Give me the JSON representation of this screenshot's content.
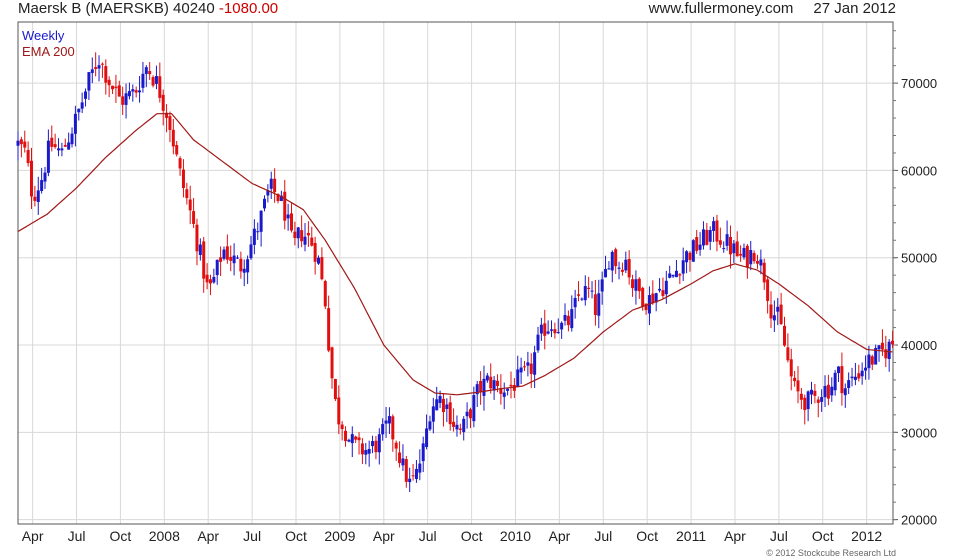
{
  "header": {
    "title": "Maersk B (MAERSKB)",
    "price": "40240",
    "change": "-1080.00",
    "source": "www.fullermoney.com",
    "date": "27 Jan 2012"
  },
  "footer": {
    "copyright": "© 2012 Stockcube Research Ltd"
  },
  "colors": {
    "up": "#1a1acc",
    "down": "#e01010",
    "ema": "#a01818",
    "grid": "#d8d8d8"
  },
  "chart_data": {
    "type": "candlestick",
    "legend": [
      "Weekly",
      "EMA 200"
    ],
    "legend_colors": [
      "#1a1acc",
      "#a01818"
    ],
    "legend_placement": "top-left",
    "x_ticks": [
      "Apr",
      "Jul",
      "Oct",
      "2008",
      "Apr",
      "Jul",
      "Oct",
      "2009",
      "Apr",
      "Jul",
      "Oct",
      "2010",
      "Apr",
      "Jul",
      "Oct",
      "2011",
      "Apr",
      "Jul",
      "Oct",
      "2012"
    ],
    "x_range_months": [
      0,
      59.8
    ],
    "y_ticks": [
      20000,
      30000,
      40000,
      50000,
      60000,
      70000
    ],
    "y_tick_labels": [
      "20000",
      "30000",
      "40000",
      "50000",
      "60000",
      "70000"
    ],
    "ylim": [
      19500,
      77000
    ],
    "y_axis_side": "right",
    "grid": true,
    "close_keyframes_month_value": [
      [
        0,
        63000
      ],
      [
        0.5,
        62000
      ],
      [
        1,
        57000
      ],
      [
        1.6,
        59000
      ],
      [
        2.2,
        63000
      ],
      [
        3,
        62000
      ],
      [
        4,
        66000
      ],
      [
        4.8,
        70000
      ],
      [
        5.5,
        73000
      ],
      [
        6.3,
        70000
      ],
      [
        7,
        68000
      ],
      [
        8,
        69000
      ],
      [
        8.8,
        72000
      ],
      [
        9.5,
        70000
      ],
      [
        10.3,
        66000
      ],
      [
        11,
        60000
      ],
      [
        11.8,
        55000
      ],
      [
        12.5,
        50000
      ],
      [
        13,
        46000
      ],
      [
        13.5,
        48000
      ],
      [
        14,
        51000
      ],
      [
        14.6,
        50000
      ],
      [
        15.2,
        49000
      ],
      [
        15.8,
        51000
      ],
      [
        16.5,
        54000
      ],
      [
        17.2,
        58000
      ],
      [
        17.8,
        57000
      ],
      [
        18.3,
        55000
      ],
      [
        18.8,
        51000
      ],
      [
        19.3,
        53000
      ],
      [
        20,
        52000
      ],
      [
        20.5,
        50000
      ],
      [
        21,
        45000
      ],
      [
        21.4,
        37000
      ],
      [
        21.8,
        32000
      ],
      [
        22.2,
        31000
      ],
      [
        22.7,
        29000
      ],
      [
        23.3,
        28000
      ],
      [
        24,
        28000
      ],
      [
        24.7,
        29000
      ],
      [
        25.3,
        31000
      ],
      [
        25.8,
        29000
      ],
      [
        26.3,
        26000
      ],
      [
        26.8,
        24000
      ],
      [
        27.2,
        25000
      ],
      [
        27.7,
        28000
      ],
      [
        28.2,
        33000
      ],
      [
        28.8,
        34000
      ],
      [
        29.3,
        33000
      ],
      [
        29.8,
        31000
      ],
      [
        30.3,
        30000
      ],
      [
        30.8,
        32000
      ],
      [
        31.5,
        35000
      ],
      [
        32.2,
        36000
      ],
      [
        32.8,
        35000
      ],
      [
        33.5,
        35000
      ],
      [
        34.2,
        36000
      ],
      [
        35,
        37000
      ],
      [
        35.5,
        40000
      ],
      [
        36,
        42000
      ],
      [
        36.6,
        42500
      ],
      [
        37.2,
        42000
      ],
      [
        37.8,
        43000
      ],
      [
        38.4,
        46000
      ],
      [
        39,
        46000
      ],
      [
        39.5,
        44000
      ],
      [
        40,
        47000
      ],
      [
        40.5,
        51000
      ],
      [
        41,
        49000
      ],
      [
        41.5,
        50000
      ],
      [
        42,
        47000
      ],
      [
        42.5,
        46000
      ],
      [
        43,
        45000
      ],
      [
        43.6,
        46000
      ],
      [
        44.2,
        47000
      ],
      [
        44.8,
        48000
      ],
      [
        45.5,
        50000
      ],
      [
        46.2,
        51000
      ],
      [
        46.8,
        52000
      ],
      [
        47.5,
        53000
      ],
      [
        48.2,
        52000
      ],
      [
        48.8,
        51000
      ],
      [
        49.3,
        50000
      ],
      [
        49.8,
        50000
      ],
      [
        50.4,
        51000
      ],
      [
        51,
        48000
      ],
      [
        51.5,
        44000
      ],
      [
        52,
        43000
      ],
      [
        52.5,
        39000
      ],
      [
        53,
        35000
      ],
      [
        53.5,
        34000
      ],
      [
        54,
        33500
      ],
      [
        54.5,
        34000
      ],
      [
        55,
        35000
      ],
      [
        55.5,
        35000
      ],
      [
        56,
        37000
      ],
      [
        56.5,
        35000
      ],
      [
        57,
        36000
      ],
      [
        57.5,
        37000
      ],
      [
        58,
        38000
      ],
      [
        58.5,
        38500
      ],
      [
        59,
        39000
      ],
      [
        59.8,
        40240
      ]
    ],
    "ema_points_month_value": [
      [
        0,
        53000
      ],
      [
        2,
        55000
      ],
      [
        4,
        58000
      ],
      [
        6,
        61500
      ],
      [
        8,
        64500
      ],
      [
        9.5,
        66500
      ],
      [
        10.5,
        66500
      ],
      [
        12,
        63500
      ],
      [
        14,
        61000
      ],
      [
        16,
        58500
      ],
      [
        18,
        57000
      ],
      [
        19.5,
        55500
      ],
      [
        21,
        52000
      ],
      [
        23,
        46500
      ],
      [
        25,
        40000
      ],
      [
        27,
        36000
      ],
      [
        28.5,
        34500
      ],
      [
        30,
        34300
      ],
      [
        31.5,
        34600
      ],
      [
        33,
        35000
      ],
      [
        34.5,
        35300
      ],
      [
        36,
        36500
      ],
      [
        38,
        38500
      ],
      [
        40,
        41500
      ],
      [
        42,
        44000
      ],
      [
        44,
        45200
      ],
      [
        46,
        47000
      ],
      [
        47.5,
        48500
      ],
      [
        49,
        49300
      ],
      [
        50.5,
        48600
      ],
      [
        52,
        47000
      ],
      [
        54,
        44500
      ],
      [
        56,
        41500
      ],
      [
        58,
        39500
      ],
      [
        59.8,
        39200
      ]
    ]
  }
}
